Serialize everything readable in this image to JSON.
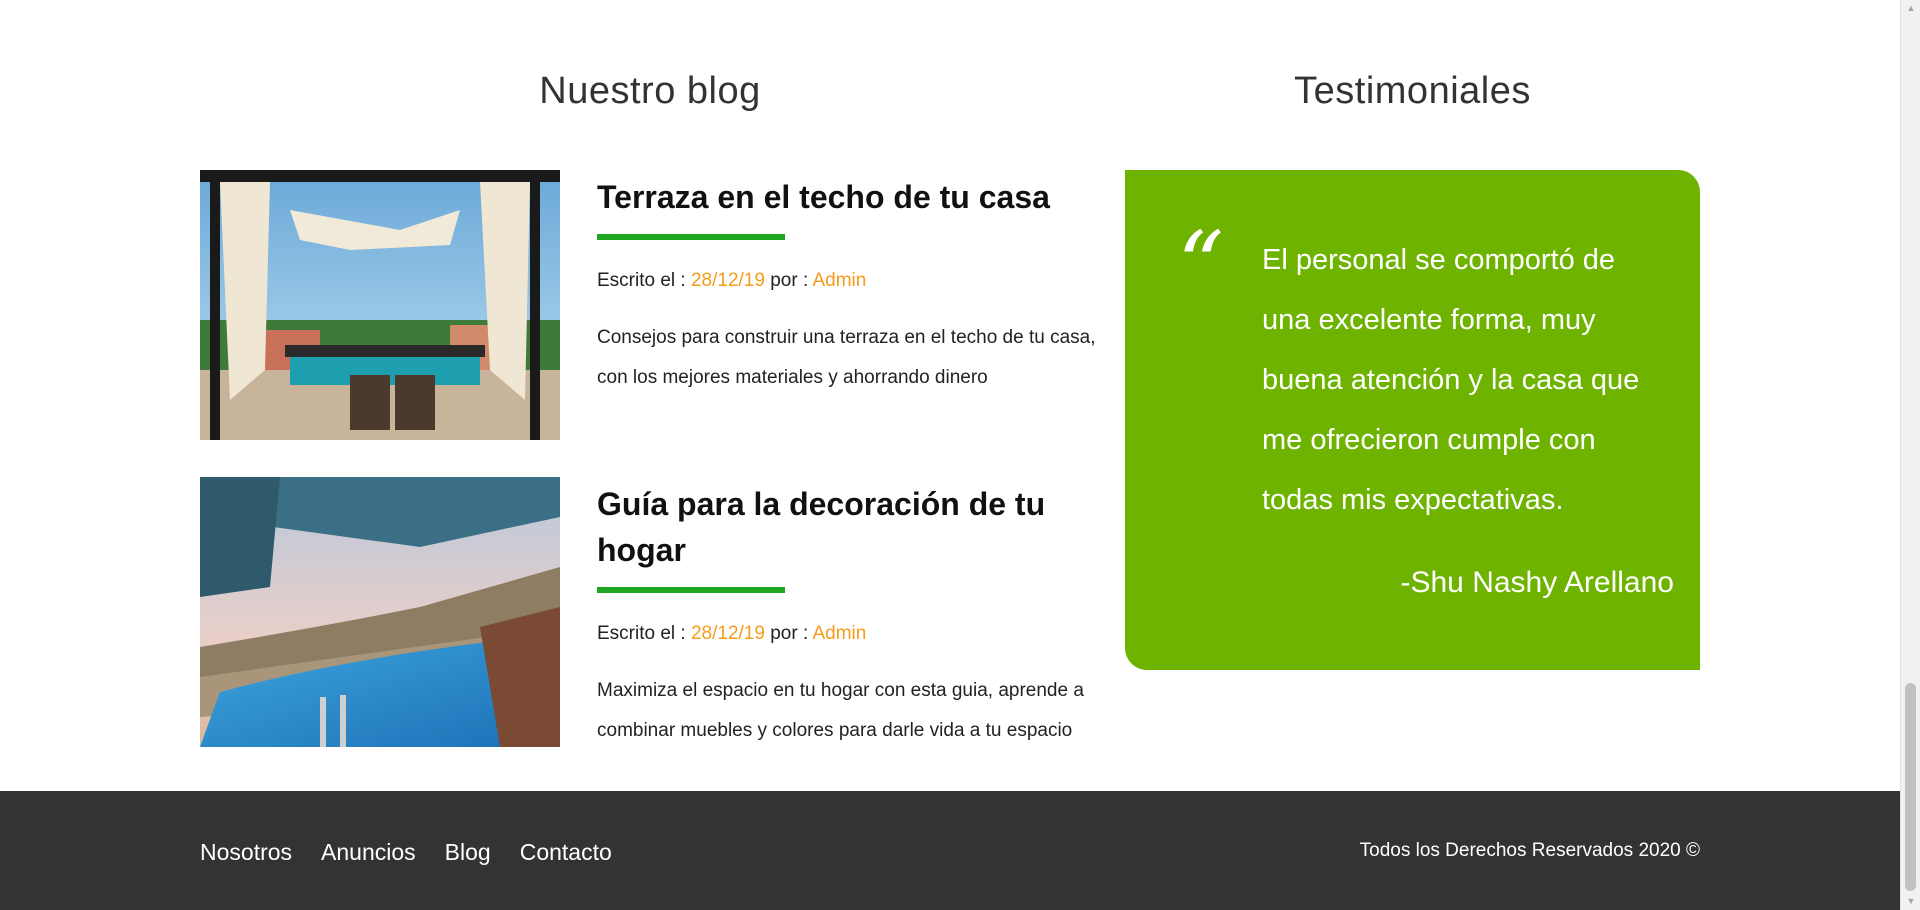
{
  "blog": {
    "title": "Nuestro blog",
    "entries": [
      {
        "title": "Terraza en el techo de tu casa",
        "meta_prefix": "Escrito el : ",
        "date": "28/12/19",
        "meta_by": " por : ",
        "author": "Admin",
        "excerpt": "Consejos para construir una terraza en el techo de tu casa, con los mejores materiales y ahorrando dinero"
      },
      {
        "title": "Guía para la decoración de tu hogar",
        "meta_prefix": "Escrito el : ",
        "date": "28/12/19",
        "meta_by": " por : ",
        "author": "Admin",
        "excerpt": "Maximiza el espacio en tu hogar con esta guia, aprende a combinar muebles y colores para darle vida a tu espacio"
      }
    ]
  },
  "testimonials": {
    "title": "Testimoniales",
    "quote_mark": "“",
    "quote": "El personal se comportó de una excelente forma, muy buena atención y la casa que me ofrecieron cumple con todas mis expectativas.",
    "author": "-Shu Nashy Arellano"
  },
  "footer": {
    "nav": [
      "Nosotros",
      "Anuncios",
      "Blog",
      "Contacto"
    ],
    "copyright": "Todos los Derechos Reservados 2020 ©"
  },
  "colors": {
    "accent_green_bar": "#20a520",
    "testimonial_bg": "#6eb300",
    "meta_accent": "#f59c1a",
    "footer_bg": "#333333"
  },
  "icons": {
    "quote": "quote-icon",
    "scroll_up": "scroll-up-arrow-icon",
    "scroll_down": "scroll-down-arrow-icon"
  }
}
